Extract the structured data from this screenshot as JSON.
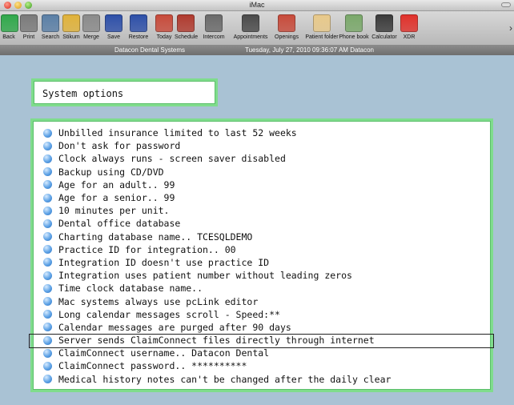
{
  "window": {
    "title": "iMac"
  },
  "toolbar": {
    "buttons": [
      {
        "label": "Back",
        "icon": "back-arrow-icon",
        "color": "#2fa84a"
      },
      {
        "label": "Print",
        "icon": "printer-icon",
        "color": "#7a7a7a"
      },
      {
        "label": "Search",
        "icon": "magnifier-icon",
        "color": "#5a7fa6"
      },
      {
        "label": "Stikum",
        "icon": "sticky-note-icon",
        "color": "#e0b23a"
      },
      {
        "label": "Merge",
        "icon": "merge-icon",
        "color": "#8a8a8a"
      },
      {
        "label": "Save",
        "icon": "save-disk-icon",
        "color": "#2d4fa8"
      },
      {
        "label": "Restore",
        "icon": "restore-disk-icon",
        "color": "#2d4fa8"
      },
      {
        "label": "Today",
        "icon": "calendar-today-icon",
        "color": "#c84a3a"
      },
      {
        "label": "Schedule",
        "icon": "schedule-grid-icon",
        "color": "#b03a2e"
      },
      {
        "label": "Intercom",
        "icon": "intercom-icon",
        "color": "#6a6a6a"
      },
      {
        "label": "Appointments",
        "icon": "people-icon",
        "color": "#4a4a4a"
      },
      {
        "label": "Openings",
        "icon": "openings-calendar-icon",
        "color": "#c84a3a"
      },
      {
        "label": "Patient folder",
        "icon": "folder-icon",
        "color": "#e8c98a"
      },
      {
        "label": "Phone book",
        "icon": "phone-book-icon",
        "color": "#7aa86a"
      },
      {
        "label": "Calculator",
        "icon": "calculator-icon",
        "color": "#3a3a3a"
      },
      {
        "label": "XDR",
        "icon": "xdr-arrow-icon",
        "color": "#e0302a"
      }
    ],
    "overflow_glyph": "›"
  },
  "infobar": {
    "company": "Datacon Dental Systems",
    "stamp": "Tuesday, July 27, 2010  09:36:07 AM  Datacon"
  },
  "panel": {
    "title": "System options"
  },
  "options": [
    "Unbilled insurance limited to last 52 weeks",
    "Don't ask for password",
    "Clock always runs - screen saver disabled",
    "Backup using CD/DVD",
    "Age for an adult.. 99",
    "Age for a senior.. 99",
    "10 minutes per unit.",
    "Dental office database",
    "Charting database name.. TCESQLDEMO",
    "Practice ID for integration.. 00",
    "Integration ID doesn't use practice ID",
    "Integration uses patient number without leading zeros",
    "Time clock database name..",
    "Mac systems always use pcLink editor",
    "Long calendar messages scroll - Speed:**",
    "Calendar messages are purged after 90 days",
    "Server sends ClaimConnect files directly through internet",
    "ClaimConnect username.. Datacon Dental",
    "ClaimConnect password.. **********",
    "Medical history notes can't be changed after the daily clear"
  ],
  "selected_option": "Server sends ClaimConnect files directly through internet",
  "colors": {
    "accent_border": "#7fdc8c",
    "background": "#a9c2d4",
    "bullet": "#5fa3e6"
  }
}
